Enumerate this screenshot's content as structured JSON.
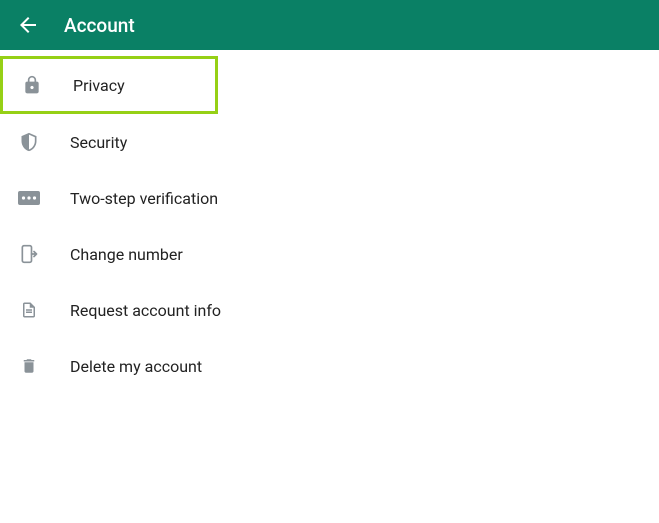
{
  "header": {
    "title": "Account"
  },
  "menu": {
    "items": [
      {
        "label": "Privacy"
      },
      {
        "label": "Security"
      },
      {
        "label": "Two-step verification"
      },
      {
        "label": "Change number"
      },
      {
        "label": "Request account info"
      },
      {
        "label": "Delete my account"
      }
    ]
  }
}
